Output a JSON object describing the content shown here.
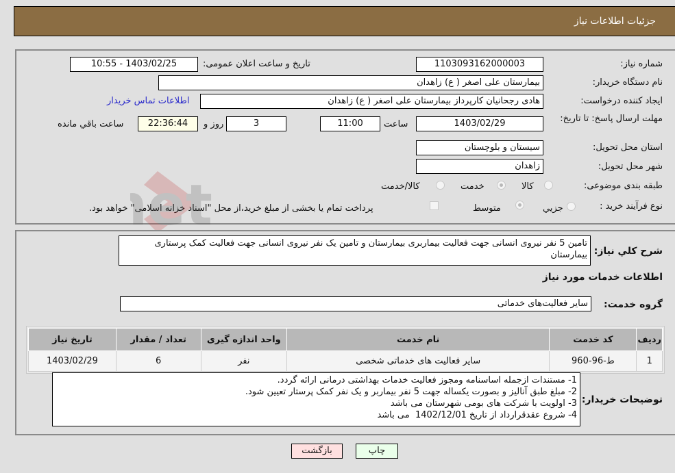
{
  "header": {
    "title": "جزئیات اطلاعات نیاز"
  },
  "details": {
    "need_number": {
      "label": "شماره نیاز:",
      "value": "1103093162000003"
    },
    "announce_datetime": {
      "label": "تاریخ و ساعت اعلان عمومی:",
      "value": "1403/02/25 - 10:55"
    },
    "buyer_org": {
      "label": "نام دستگاه خریدار:",
      "value": "بیمارستان علی اصغر ( ع) زاهدان"
    },
    "requester": {
      "label": "ایجاد کننده درخواست:",
      "value": "هادی رجحانیان کارپرداز بیمارستان علی اصغر ( ع) زاهدان"
    },
    "buyer_contact_link": "اطلاعات تماس خریدار",
    "deadline": {
      "label": "مهلت ارسال پاسخ: تا تاریخ:",
      "date": "1403/02/29",
      "time_label": "ساعت",
      "time": "11:00",
      "days": "3",
      "days_label": "روز و",
      "remaining": "22:36:44",
      "remaining_label": "ساعت باقي مانده"
    },
    "province": {
      "label": "استان محل تحویل:",
      "value": "سیستان و بلوچستان"
    },
    "city": {
      "label": "شهر محل تحویل:",
      "value": "زاهدان"
    },
    "category": {
      "label": "طبقه بندی موضوعی:",
      "options": [
        "کالا",
        "خدمت",
        "کالا/خدمت"
      ],
      "selected": "خدمت"
    },
    "purchase_type": {
      "label": "نوع فرآیند خرید :",
      "options": [
        "جزيي",
        "متوسط"
      ],
      "selected": "متوسط",
      "treasury_note": "پرداخت تمام یا بخشی از مبلغ خرید،از محل \"اسناد خزانه اسلامی\" خواهد بود.",
      "treasury_checked": false
    }
  },
  "summary": {
    "label": "شرح کلي نیاز:",
    "value": "تامین 5 نفر نیروی انسانی جهت فعالیت بیماربری بیمارستان و تامین یک نفر نیروی انسانی جهت فعالیت کمک پرستاری بیمارستان"
  },
  "services": {
    "section_title": "اطلاعات خدمات مورد نیاز",
    "group_label": "گروه خدمت:",
    "group_value": "سایر فعالیت‌های خدماتی",
    "table": {
      "headers": [
        "ردیف",
        "کد خدمت",
        "نام خدمت",
        "واحد اندازه گیری",
        "تعداد / مقدار",
        "تاریخ نیاز"
      ],
      "rows": [
        [
          "1",
          "ط-96-960",
          "سایر فعالیت های خدماتی شخصی",
          "نفر",
          "6",
          "1403/02/29"
        ]
      ]
    }
  },
  "buyer_notes": {
    "label": "توضیحات خریدار:",
    "value": "1- مستندات ازجمله اساسنامه ومجوز فعالیت خدمات بهداشتی درمانی ارائه گردد.\n2- مبلغ طبق آنالیز و بصورت یکساله جهت 5 نفر بیماربر و یک نفر کمک پرستار تعیین شود.\n3- اولویت با شرکت های بومی شهرستان می باشد\n4- شروع عقدقرارداد از تاریخ 1402/12/01  می باشد"
  },
  "buttons": {
    "print": "چاپ",
    "back": "بازگشت"
  },
  "colors": {
    "header_bg": "#8b6d43",
    "print_bg": "#eaffea",
    "back_bg": "#ffe0e0",
    "link": "#2a2acb"
  },
  "watermark": {
    "text": "AriaTender.net"
  }
}
